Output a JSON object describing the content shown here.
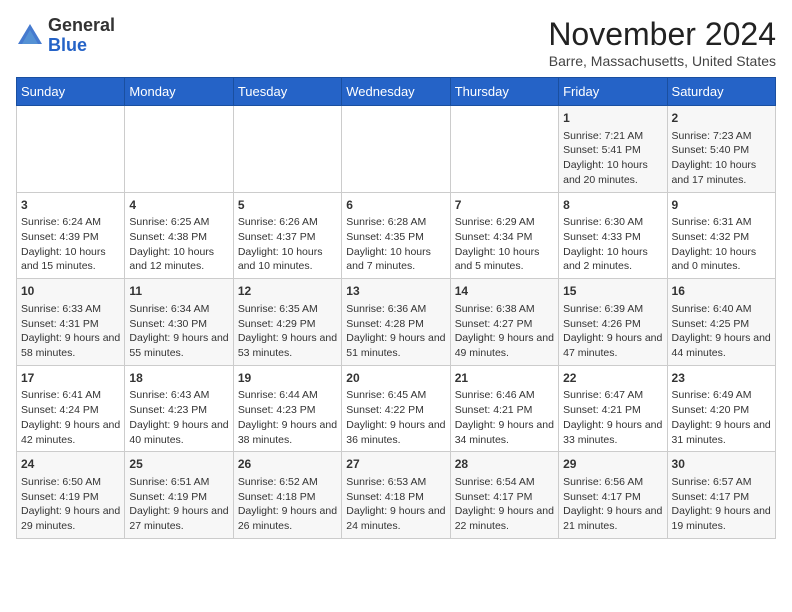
{
  "header": {
    "logo_line1": "General",
    "logo_line2": "Blue",
    "title": "November 2024",
    "subtitle": "Barre, Massachusetts, United States"
  },
  "weekdays": [
    "Sunday",
    "Monday",
    "Tuesday",
    "Wednesday",
    "Thursday",
    "Friday",
    "Saturday"
  ],
  "weeks": [
    [
      {
        "day": "",
        "content": ""
      },
      {
        "day": "",
        "content": ""
      },
      {
        "day": "",
        "content": ""
      },
      {
        "day": "",
        "content": ""
      },
      {
        "day": "",
        "content": ""
      },
      {
        "day": "1",
        "content": "Sunrise: 7:21 AM\nSunset: 5:41 PM\nDaylight: 10 hours and 20 minutes."
      },
      {
        "day": "2",
        "content": "Sunrise: 7:23 AM\nSunset: 5:40 PM\nDaylight: 10 hours and 17 minutes."
      }
    ],
    [
      {
        "day": "3",
        "content": "Sunrise: 6:24 AM\nSunset: 4:39 PM\nDaylight: 10 hours and 15 minutes."
      },
      {
        "day": "4",
        "content": "Sunrise: 6:25 AM\nSunset: 4:38 PM\nDaylight: 10 hours and 12 minutes."
      },
      {
        "day": "5",
        "content": "Sunrise: 6:26 AM\nSunset: 4:37 PM\nDaylight: 10 hours and 10 minutes."
      },
      {
        "day": "6",
        "content": "Sunrise: 6:28 AM\nSunset: 4:35 PM\nDaylight: 10 hours and 7 minutes."
      },
      {
        "day": "7",
        "content": "Sunrise: 6:29 AM\nSunset: 4:34 PM\nDaylight: 10 hours and 5 minutes."
      },
      {
        "day": "8",
        "content": "Sunrise: 6:30 AM\nSunset: 4:33 PM\nDaylight: 10 hours and 2 minutes."
      },
      {
        "day": "9",
        "content": "Sunrise: 6:31 AM\nSunset: 4:32 PM\nDaylight: 10 hours and 0 minutes."
      }
    ],
    [
      {
        "day": "10",
        "content": "Sunrise: 6:33 AM\nSunset: 4:31 PM\nDaylight: 9 hours and 58 minutes."
      },
      {
        "day": "11",
        "content": "Sunrise: 6:34 AM\nSunset: 4:30 PM\nDaylight: 9 hours and 55 minutes."
      },
      {
        "day": "12",
        "content": "Sunrise: 6:35 AM\nSunset: 4:29 PM\nDaylight: 9 hours and 53 minutes."
      },
      {
        "day": "13",
        "content": "Sunrise: 6:36 AM\nSunset: 4:28 PM\nDaylight: 9 hours and 51 minutes."
      },
      {
        "day": "14",
        "content": "Sunrise: 6:38 AM\nSunset: 4:27 PM\nDaylight: 9 hours and 49 minutes."
      },
      {
        "day": "15",
        "content": "Sunrise: 6:39 AM\nSunset: 4:26 PM\nDaylight: 9 hours and 47 minutes."
      },
      {
        "day": "16",
        "content": "Sunrise: 6:40 AM\nSunset: 4:25 PM\nDaylight: 9 hours and 44 minutes."
      }
    ],
    [
      {
        "day": "17",
        "content": "Sunrise: 6:41 AM\nSunset: 4:24 PM\nDaylight: 9 hours and 42 minutes."
      },
      {
        "day": "18",
        "content": "Sunrise: 6:43 AM\nSunset: 4:23 PM\nDaylight: 9 hours and 40 minutes."
      },
      {
        "day": "19",
        "content": "Sunrise: 6:44 AM\nSunset: 4:23 PM\nDaylight: 9 hours and 38 minutes."
      },
      {
        "day": "20",
        "content": "Sunrise: 6:45 AM\nSunset: 4:22 PM\nDaylight: 9 hours and 36 minutes."
      },
      {
        "day": "21",
        "content": "Sunrise: 6:46 AM\nSunset: 4:21 PM\nDaylight: 9 hours and 34 minutes."
      },
      {
        "day": "22",
        "content": "Sunrise: 6:47 AM\nSunset: 4:21 PM\nDaylight: 9 hours and 33 minutes."
      },
      {
        "day": "23",
        "content": "Sunrise: 6:49 AM\nSunset: 4:20 PM\nDaylight: 9 hours and 31 minutes."
      }
    ],
    [
      {
        "day": "24",
        "content": "Sunrise: 6:50 AM\nSunset: 4:19 PM\nDaylight: 9 hours and 29 minutes."
      },
      {
        "day": "25",
        "content": "Sunrise: 6:51 AM\nSunset: 4:19 PM\nDaylight: 9 hours and 27 minutes."
      },
      {
        "day": "26",
        "content": "Sunrise: 6:52 AM\nSunset: 4:18 PM\nDaylight: 9 hours and 26 minutes."
      },
      {
        "day": "27",
        "content": "Sunrise: 6:53 AM\nSunset: 4:18 PM\nDaylight: 9 hours and 24 minutes."
      },
      {
        "day": "28",
        "content": "Sunrise: 6:54 AM\nSunset: 4:17 PM\nDaylight: 9 hours and 22 minutes."
      },
      {
        "day": "29",
        "content": "Sunrise: 6:56 AM\nSunset: 4:17 PM\nDaylight: 9 hours and 21 minutes."
      },
      {
        "day": "30",
        "content": "Sunrise: 6:57 AM\nSunset: 4:17 PM\nDaylight: 9 hours and 19 minutes."
      }
    ]
  ]
}
